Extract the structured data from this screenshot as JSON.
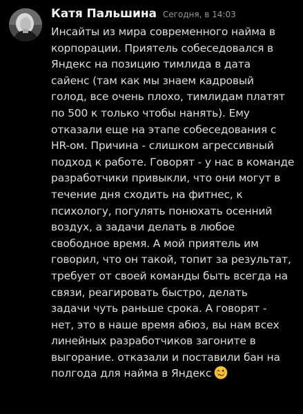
{
  "message": {
    "author": "Катя Пальшина",
    "timestamp": "Сегодня, в 14:03",
    "lines": [
      "Инсайты из мира современного найма в",
      "корпорации. Приятель собеседовался в",
      "Яндекс на позицию тимлида в дата",
      "сайенс (там как мы знаем кадровый",
      "голод, все очень плохо, тимлидам платят",
      "по 500 к только чтобы нанять). Ему",
      "отказали еще на этапе собеседования с",
      "HR-ом. Причина - слишком агрессивный",
      "подход к работе. Говорят - у нас в команде",
      "разработчики привыкли, что они могут в",
      "течение дня сходить на фитнес, к",
      "психологу, погулять понюхать осенний",
      "воздух, а задачи делать в любое",
      "свободное время. А мой приятель им",
      "говорил, что он такой, топит за результат,",
      "требует от своей команды быть всегда на",
      "связи, реагировать быстро, делать",
      "задачи чуть раньше срока. А говорят -",
      "нет, это в наше время абюз, вы нам всех",
      "линейных разработчиков загоните в",
      "выгорание. отказали и поставили бан на",
      "полгода для найма в Яндекс"
    ],
    "emoji": "woozy-face-emoji"
  },
  "colors": {
    "background": "#000000",
    "author": "#f2f3f5",
    "timestamp": "#96989d",
    "body_text": "#dcddde"
  }
}
